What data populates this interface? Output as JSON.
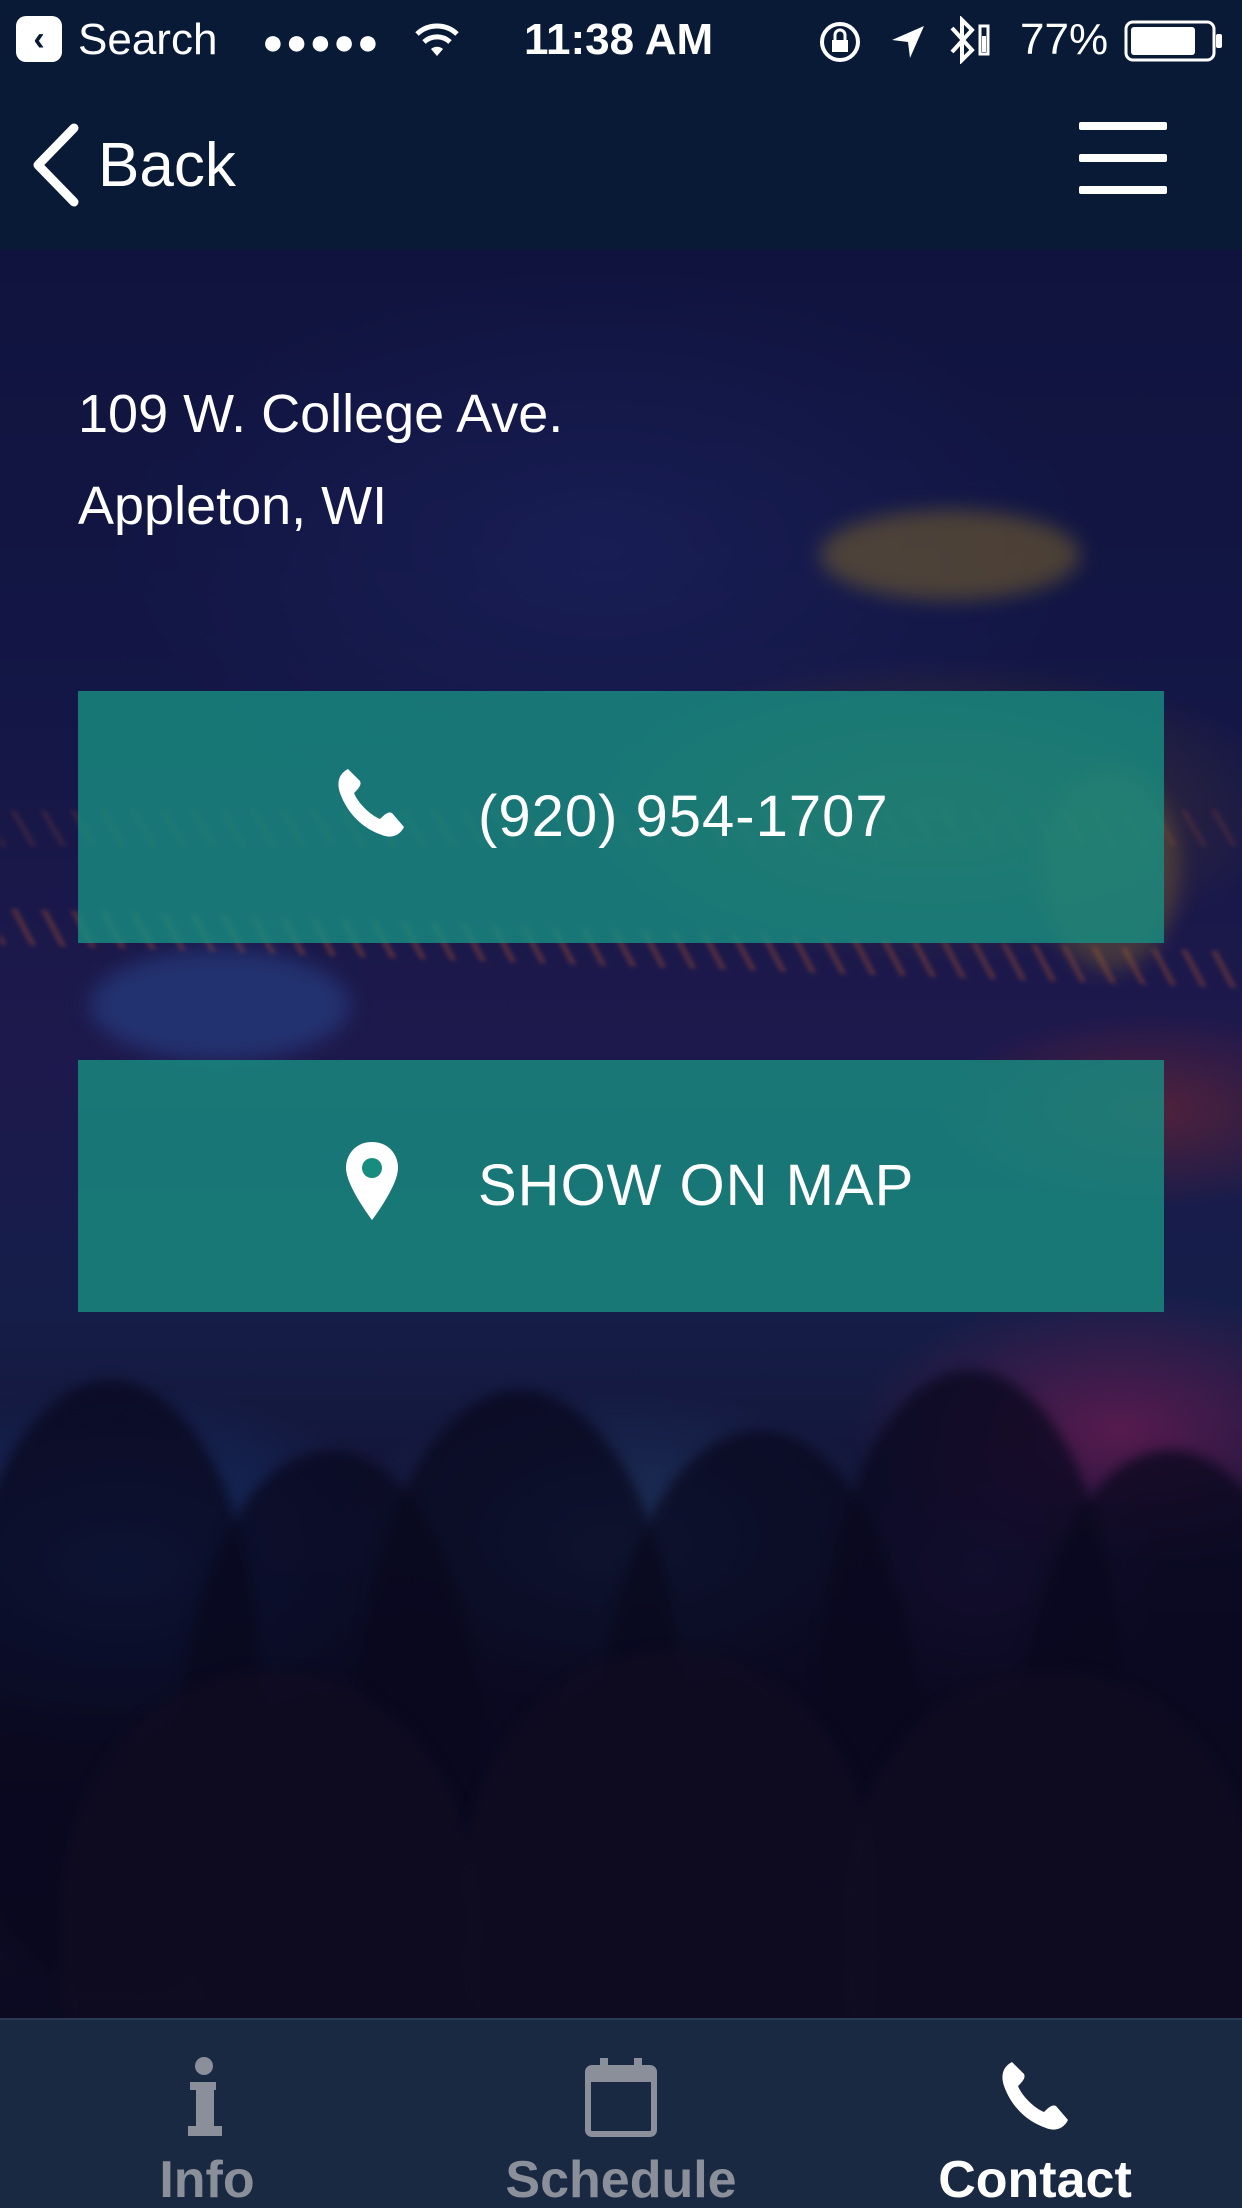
{
  "status_bar": {
    "back_app": "Search",
    "signal": "●●●●●",
    "time": "11:38 AM",
    "battery_percent": "77%",
    "icons": [
      "back-app-icon",
      "wifi-icon",
      "orientation-lock-icon",
      "location-arrow-icon",
      "bluetooth-icon",
      "battery-icon"
    ]
  },
  "nav": {
    "back_label": "Back",
    "icons": [
      "chevron-left-icon",
      "hamburger-menu-icon"
    ]
  },
  "address": {
    "line1": "109 W. College Ave.",
    "line2": "Appleton, WI"
  },
  "actions": {
    "phone": {
      "label": "(920) 954-1707",
      "icon": "phone-icon"
    },
    "map": {
      "label": "SHOW ON MAP",
      "icon": "map-pin-icon"
    }
  },
  "tabs": [
    {
      "label": "Info",
      "icon": "info-icon",
      "active": false
    },
    {
      "label": "Schedule",
      "icon": "calendar-icon",
      "active": false
    },
    {
      "label": "Contact",
      "icon": "phone-icon",
      "active": true
    }
  ],
  "colors": {
    "header_bg": "#081a35",
    "button_bg": "#198c80",
    "tabbar_bg": "#1a2942",
    "tab_inactive": "#8a8f99",
    "tab_active": "#ffffff"
  }
}
